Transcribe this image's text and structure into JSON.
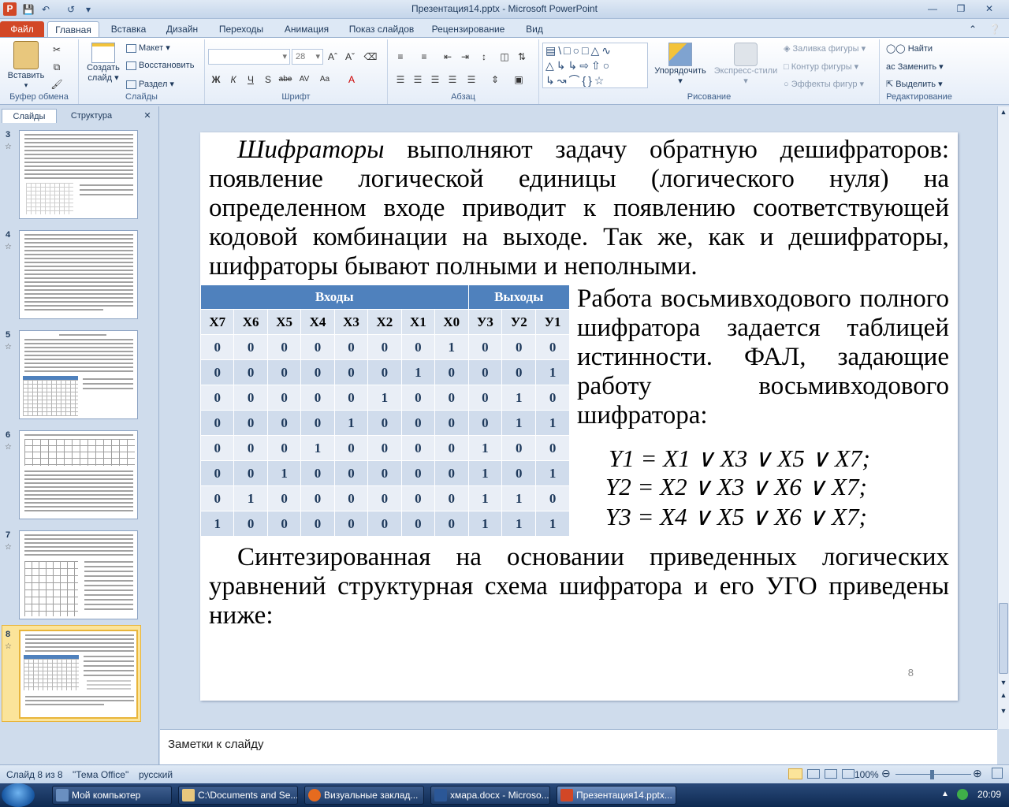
{
  "window": {
    "title": "Презентация14.pptx - Microsoft PowerPoint"
  },
  "ribbon": {
    "tabs": [
      "Файл",
      "Главная",
      "Вставка",
      "Дизайн",
      "Переходы",
      "Анимация",
      "Показ слайдов",
      "Рецензирование",
      "Вид"
    ],
    "active_tab": "Главная",
    "groups": {
      "clipboard": {
        "label": "Буфер обмена",
        "paste": "Вставить"
      },
      "slides": {
        "label": "Слайды",
        "new_slide_1": "Создать",
        "new_slide_2": "слайд",
        "layout": "Макет",
        "reset": "Восстановить",
        "section": "Раздел"
      },
      "font": {
        "label": "Шрифт",
        "font_size": "28"
      },
      "paragraph": {
        "label": "Абзац"
      },
      "drawing": {
        "label": "Рисование",
        "arrange": "Упорядочить",
        "quick_styles": "Экспресс-стили",
        "fill": "Заливка фигуры",
        "outline": "Контур фигуры",
        "effects": "Эффекты фигур"
      },
      "editing": {
        "label": "Редактирование",
        "find": "Найти",
        "replace": "Заменить",
        "select": "Выделить"
      }
    }
  },
  "left_panel": {
    "tabs": [
      "Слайды",
      "Структура"
    ],
    "active_tab": "Слайды",
    "thumbnails": [
      "3",
      "4",
      "5",
      "6",
      "7",
      "8"
    ],
    "selected": "8"
  },
  "slide": {
    "para1_italic": "Шифраторы",
    "para1_rest": " выполняют задачу обратную дешифраторов: появление логической единицы (логического нуля) на определенном входе приводит к появлению соответствующей кодовой комбинации на выходе. Так же, как и дешифраторы, шифраторы бывают полными и неполными.",
    "side_text": "Работа восьмивходового полного шифратора задается таблицей истинности. ФАЛ, задающие работу восьмивходового шифратора:",
    "table": {
      "group_inputs": "Входы",
      "group_outputs": "Выходы",
      "columns": [
        "X7",
        "X6",
        "X5",
        "X4",
        "X3",
        "X2",
        "X1",
        "X0",
        "У3",
        "У2",
        "У1"
      ],
      "rows": [
        [
          "0",
          "0",
          "0",
          "0",
          "0",
          "0",
          "0",
          "1",
          "0",
          "0",
          "0"
        ],
        [
          "0",
          "0",
          "0",
          "0",
          "0",
          "0",
          "1",
          "0",
          "0",
          "0",
          "1"
        ],
        [
          "0",
          "0",
          "0",
          "0",
          "0",
          "1",
          "0",
          "0",
          "0",
          "1",
          "0"
        ],
        [
          "0",
          "0",
          "0",
          "0",
          "1",
          "0",
          "0",
          "0",
          "0",
          "1",
          "1"
        ],
        [
          "0",
          "0",
          "0",
          "1",
          "0",
          "0",
          "0",
          "0",
          "1",
          "0",
          "0"
        ],
        [
          "0",
          "0",
          "1",
          "0",
          "0",
          "0",
          "0",
          "0",
          "1",
          "0",
          "1"
        ],
        [
          "0",
          "1",
          "0",
          "0",
          "0",
          "0",
          "0",
          "0",
          "1",
          "1",
          "0"
        ],
        [
          "1",
          "0",
          "0",
          "0",
          "0",
          "0",
          "0",
          "0",
          "1",
          "1",
          "1"
        ]
      ]
    },
    "formulas": [
      "Y1 = X1 ∨ X3 ∨ X5 ∨ X7;",
      "Y2 = X2 ∨ X3 ∨ X6 ∨ X7;",
      "Y3 = X4 ∨ X5 ∨ X6 ∨ X7;"
    ],
    "para2": "Синтезированная на основании приведенных логических уравнений структурная схема шифратора и его УГО приведены ниже:",
    "slide_number": "8"
  },
  "notes": {
    "placeholder": "Заметки к слайду"
  },
  "status": {
    "slide_info": "Слайд 8 из 8",
    "theme": "\"Тема Office\"",
    "language": "русский",
    "zoom": "100%"
  },
  "taskbar": {
    "items": [
      "Мой компьютер",
      "C:\\Documents and Se...",
      "Визуальные заклад...",
      "хмара.docx - Microso...",
      "Презентация14.pptx..."
    ],
    "clock": "20:09"
  },
  "colors": {
    "file_tab": "#d24726",
    "table_header": "#4f81bd",
    "selection": "#fbe49a"
  }
}
